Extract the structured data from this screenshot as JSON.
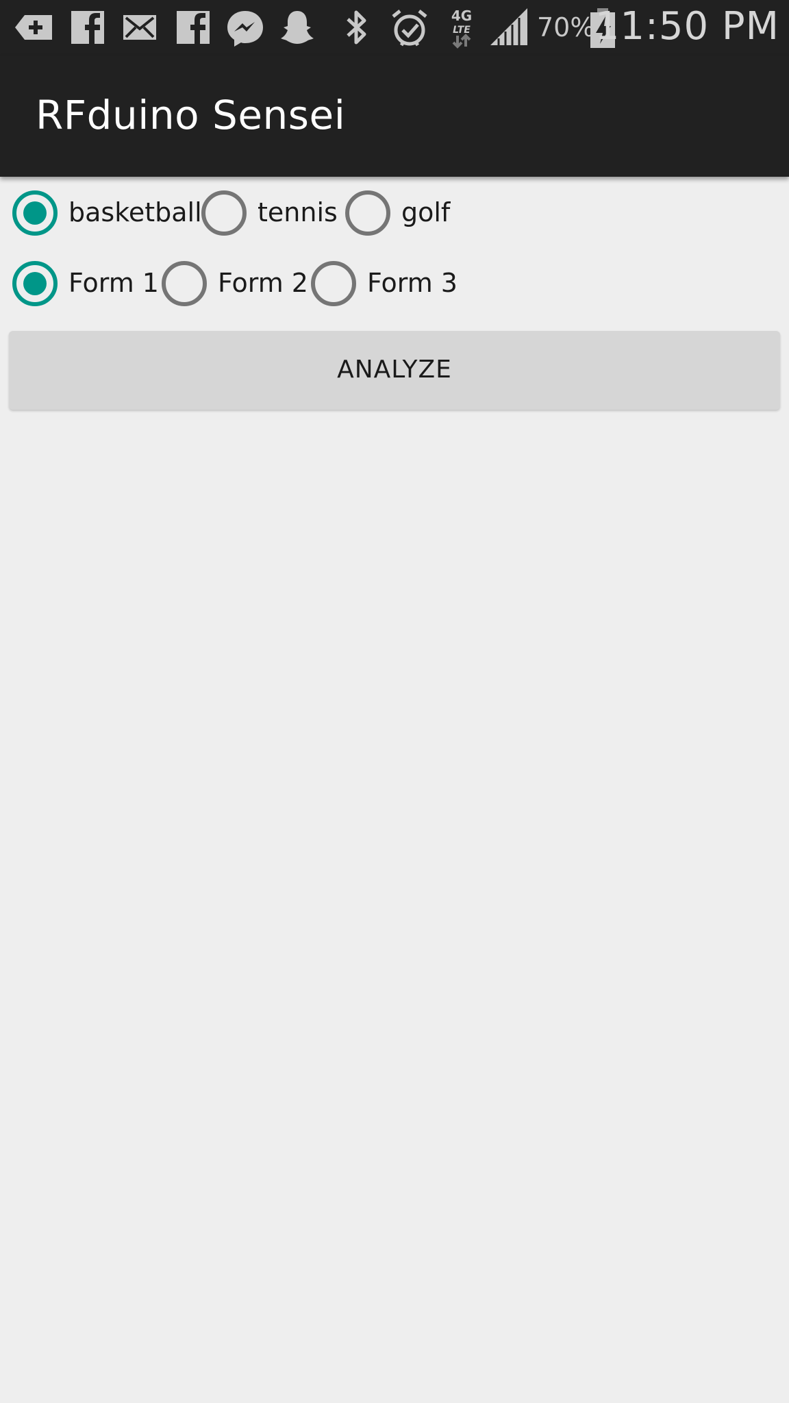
{
  "status_bar": {
    "icons": [
      "back-plus-icon",
      "facebook-icon",
      "email-icon",
      "facebook-icon",
      "messenger-icon",
      "snapchat-icon",
      "bluetooth-icon",
      "alarm-icon",
      "4g-lte-icon",
      "signal-icon",
      "battery-charging-icon"
    ],
    "network_label_top": "4G",
    "network_label_bottom": "LTE",
    "battery": "70%",
    "time": "11:50 PM"
  },
  "toolbar": {
    "title": "RFduino Sensei",
    "background": "#212121"
  },
  "sport_group": {
    "options": [
      {
        "label": "basketball",
        "checked": true
      },
      {
        "label": "tennis",
        "checked": false
      },
      {
        "label": "golf",
        "checked": false
      }
    ]
  },
  "form_group": {
    "options": [
      {
        "label": "Form 1",
        "checked": true
      },
      {
        "label": "Form 2",
        "checked": false
      },
      {
        "label": "Form 3",
        "checked": false
      }
    ]
  },
  "analyze_button": {
    "label": "ANALYZE"
  },
  "colors": {
    "accent": "#009688",
    "radio_unchecked": "#757575",
    "background": "#eeeeee",
    "button": "#d6d6d6"
  }
}
